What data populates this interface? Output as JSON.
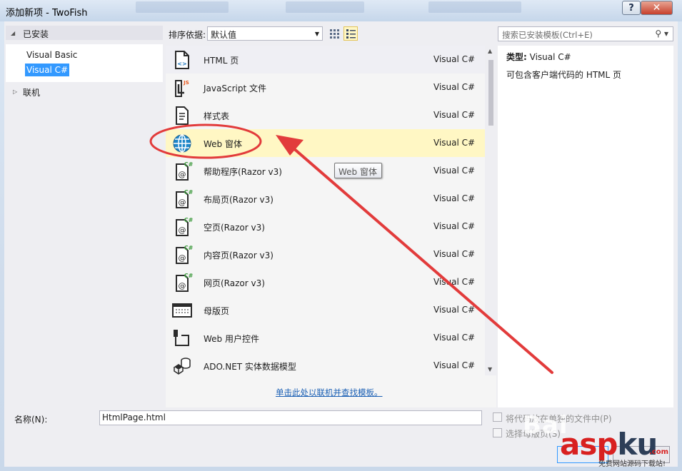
{
  "window": {
    "title": "添加新项 - TwoFish",
    "help_button": "?",
    "close_button": "✕"
  },
  "left_panel": {
    "installed_header": "已安装",
    "items": [
      {
        "label": "Visual Basic",
        "selected": false
      },
      {
        "label": "Visual C#",
        "selected": true
      }
    ],
    "online_header": "联机"
  },
  "toolbar": {
    "sort_label": "排序依据:",
    "sort_value": "默认值",
    "search_placeholder": "搜索已安装模板(Ctrl+E)"
  },
  "templates": [
    {
      "name": "HTML 页",
      "lang": "Visual C#",
      "icon": "html-page-icon"
    },
    {
      "name": "JavaScript 文件",
      "lang": "Visual C#",
      "icon": "javascript-file-icon"
    },
    {
      "name": "样式表",
      "lang": "Visual C#",
      "icon": "stylesheet-icon"
    },
    {
      "name": "Web 窗体",
      "lang": "Visual C#",
      "icon": "globe-icon"
    },
    {
      "name": "帮助程序(Razor v3)",
      "lang": "Visual C#",
      "icon": "razor-icon"
    },
    {
      "name": "布局页(Razor v3)",
      "lang": "Visual C#",
      "icon": "razor-icon"
    },
    {
      "name": "空页(Razor v3)",
      "lang": "Visual C#",
      "icon": "razor-icon"
    },
    {
      "name": "内容页(Razor v3)",
      "lang": "Visual C#",
      "icon": "razor-icon"
    },
    {
      "name": "网页(Razor v3)",
      "lang": "Visual C#",
      "icon": "razor-icon"
    },
    {
      "name": "母版页",
      "lang": "Visual C#",
      "icon": "master-page-icon"
    },
    {
      "name": "Web 用户控件",
      "lang": "Visual C#",
      "icon": "user-control-icon"
    },
    {
      "name": "ADO.NET 实体数据模型",
      "lang": "Visual C#",
      "icon": "entity-model-icon"
    }
  ],
  "online_link": "单击此处以联机并查找模板。",
  "tooltip": "Web 窗体",
  "description": {
    "type_label": "类型:",
    "type_value": "Visual C#",
    "text": "可包含客户端代码的 HTML 页"
  },
  "bottom": {
    "name_label": "名称(N):",
    "name_value": "HtmlPage.html",
    "checkbox1": "将代码放在单独的文件中(P)",
    "checkbox2": "选择母版页(S)",
    "add_button": "添加(A)",
    "cancel_button": "取消"
  },
  "watermark": {
    "baidu": "Bai",
    "aspku_1": "asp",
    "aspku_2": "ku",
    "com": ".com",
    "subtitle": "免费网站源码下载站!"
  },
  "colors": {
    "hover_row": "#fff7c4",
    "selected_tree": "#3399ff",
    "annotation": "#e23b3b"
  }
}
